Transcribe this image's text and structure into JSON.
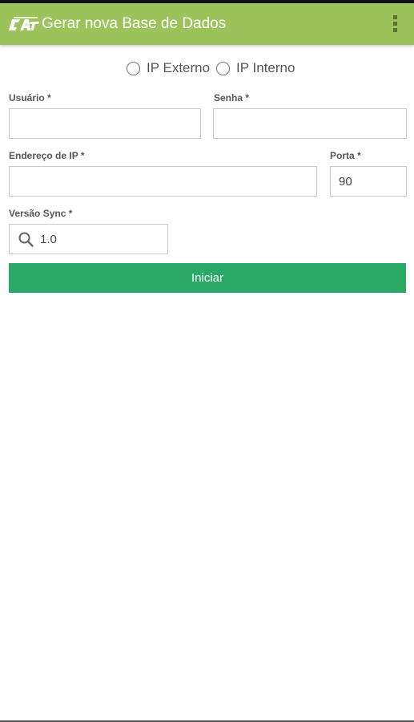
{
  "appbar": {
    "logo_icon": "car-logo-icon",
    "title": "Gerar nova Base de Dados",
    "menu_icon": "overflow-menu-icon",
    "color": "#9cc35b"
  },
  "ip_type": {
    "options": [
      {
        "label": "IP Externo",
        "selected": false
      },
      {
        "label": "IP Interno",
        "selected": false
      }
    ]
  },
  "form": {
    "usuario_label": "Usuário *",
    "usuario_value": "",
    "senha_label": "Senha *",
    "senha_value": "",
    "endereco_label": "Endereço de IP *",
    "endereco_value": "",
    "porta_label": "Porta *",
    "porta_value": "90",
    "versao_label": "Versão Sync *",
    "versao_value": "1.0",
    "versao_icon": "search-icon"
  },
  "action": {
    "start_label": "Iniciar",
    "color": "#2aa865"
  }
}
